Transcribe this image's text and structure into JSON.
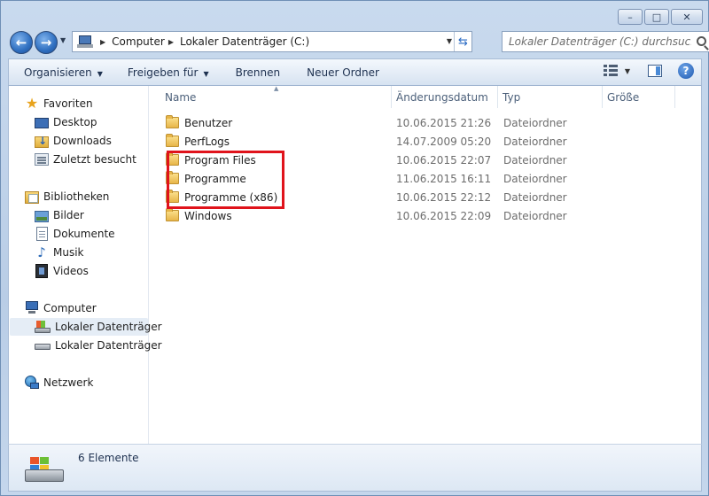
{
  "window": {
    "minimize_glyph": "–",
    "maximize_glyph": "□",
    "close_glyph": "✕"
  },
  "address_bar": {
    "breadcrumb": [
      "Computer",
      "Lokaler Datenträger (C:)"
    ],
    "search_placeholder": "Lokaler Datenträger (C:) durchsuchen"
  },
  "toolbar": {
    "organize_label": "Organisieren",
    "share_label": "Freigeben für",
    "burn_label": "Brennen",
    "new_folder_label": "Neuer Ordner"
  },
  "navigation": {
    "favorites": {
      "label": "Favoriten",
      "items": [
        "Desktop",
        "Downloads",
        "Zuletzt besucht"
      ]
    },
    "libraries": {
      "label": "Bibliotheken",
      "items": [
        "Bilder",
        "Dokumente",
        "Musik",
        "Videos"
      ]
    },
    "computer": {
      "label": "Computer",
      "items": [
        "Lokaler Datenträger",
        "Lokaler Datenträger"
      ]
    },
    "network": {
      "label": "Netzwerk"
    }
  },
  "columns": {
    "name": "Name",
    "date": "Änderungsdatum",
    "type": "Typ",
    "size": "Größe"
  },
  "files": [
    {
      "name": "Benutzer",
      "date": "10.06.2015 21:26",
      "type": "Dateiordner"
    },
    {
      "name": "PerfLogs",
      "date": "14.07.2009 05:20",
      "type": "Dateiordner"
    },
    {
      "name": "Program Files",
      "date": "10.06.2015 22:07",
      "type": "Dateiordner"
    },
    {
      "name": "Programme",
      "date": "11.06.2015 16:11",
      "type": "Dateiordner"
    },
    {
      "name": "Programme (x86)",
      "date": "10.06.2015 22:12",
      "type": "Dateiordner"
    },
    {
      "name": "Windows",
      "date": "10.06.2015 22:09",
      "type": "Dateiordner"
    }
  ],
  "highlight": {
    "color": "#e0131b",
    "rows": [
      "Program Files",
      "Programme",
      "Programme (x86)"
    ]
  },
  "details": {
    "count_label": "6 Elemente"
  }
}
